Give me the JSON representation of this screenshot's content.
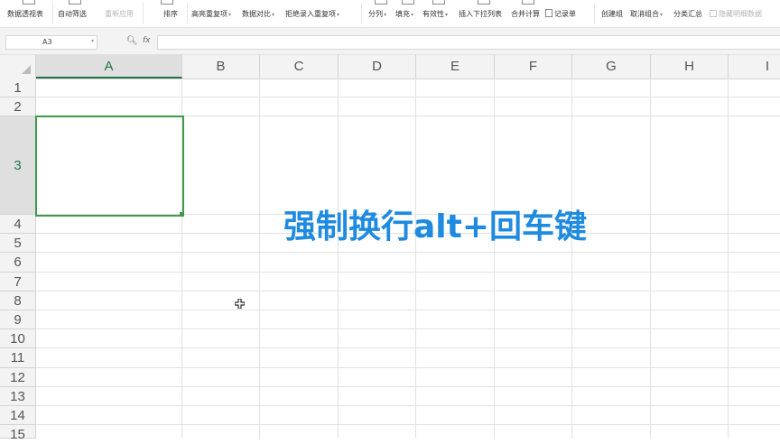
{
  "ribbon": {
    "items": [
      {
        "label": "数据透视表",
        "dd": false,
        "disabled": false
      },
      {
        "label": "自动筛选",
        "dd": false,
        "disabled": false
      },
      {
        "label": "重新应用",
        "dd": false,
        "disabled": true
      },
      {
        "label": "排序",
        "dd": false,
        "disabled": false
      },
      {
        "label": "高亮重复项",
        "dd": true,
        "disabled": false
      },
      {
        "label": "数据对比",
        "dd": true,
        "disabled": false
      },
      {
        "label": "拒绝录入重复项",
        "dd": true,
        "disabled": false
      },
      {
        "label": "分列",
        "dd": true,
        "disabled": false
      },
      {
        "label": "填充",
        "dd": true,
        "disabled": false
      },
      {
        "label": "有效性",
        "dd": true,
        "disabled": false
      },
      {
        "label": "插入下拉列表",
        "dd": false,
        "disabled": false
      },
      {
        "label": "合并计算",
        "dd": false,
        "disabled": false
      },
      {
        "label": "记录单",
        "dd": false,
        "disabled": false
      },
      {
        "label": "创建组",
        "dd": false,
        "disabled": false
      },
      {
        "label": "取消组合",
        "dd": true,
        "disabled": false
      },
      {
        "label": "分类汇总",
        "dd": false,
        "disabled": false
      },
      {
        "label": "隐藏明细数据",
        "dd": false,
        "disabled": true
      }
    ]
  },
  "formula_bar": {
    "name_box": "A3",
    "fx_label": "fx",
    "formula": ""
  },
  "columns": [
    "A",
    "B",
    "C",
    "D",
    "E",
    "F",
    "G",
    "H",
    "I"
  ],
  "rows": [
    "1",
    "2",
    "3",
    "4",
    "5",
    "6",
    "7",
    "8",
    "9",
    "10",
    "11",
    "12",
    "13",
    "14",
    "15"
  ],
  "selection": {
    "cell": "A3",
    "column": "A",
    "row": "3"
  },
  "overlay_text": "强制换行alt+回车键",
  "colors": {
    "selection": "#3f9a4c",
    "overlay": "#1e8ae0",
    "header_bg": "#f3f3f3"
  }
}
